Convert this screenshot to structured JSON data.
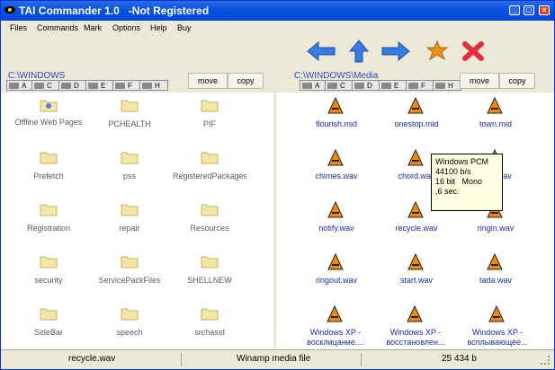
{
  "titlebar": {
    "title": "TAI Commander 1.0   -Not Registered"
  },
  "menu": [
    "Files",
    "Commands",
    "Mark",
    "Options",
    "Help",
    "Buy"
  ],
  "left_panel": {
    "path": "C:\\WINDOWS",
    "move_label": "move",
    "copy_label": "copy",
    "drives": [
      "A",
      "C",
      "D",
      "E",
      "F",
      "H"
    ],
    "items": [
      "Offline Web Pages",
      "PCHEALTH",
      "PIF",
      "Prefetch",
      "pss",
      "RegisteredPackages",
      "Registration",
      "repair",
      "Resources",
      "security",
      "ServicePackFiles",
      "SHELLNEW",
      "SideBar",
      "speech",
      "srchasst"
    ]
  },
  "right_panel": {
    "path": "C:\\WINDOWS\\Media",
    "move_label": "move",
    "copy_label": "copy",
    "drives": [
      "A",
      "C",
      "D",
      "E",
      "F",
      "H"
    ],
    "items": [
      "flourish.mid",
      "onestop.mid",
      "town.mid",
      "chimes.wav",
      "chord.wav",
      "ding.wav",
      "notify.wav",
      "recycle.wav",
      "ringin.wav",
      "ringout.wav",
      "start.wav",
      "tada.wav",
      "Windows XP - восклицание....",
      "Windows XP - восстановлен...",
      "Windows XP - всплывающее..."
    ]
  },
  "tooltip": {
    "line1": "Windows PCM",
    "line2": "44100 b/s",
    "line3": "16 bit   Mono",
    "line4": ",6 sec."
  },
  "status": {
    "file": "recycle.wav",
    "type": "Winamp media file",
    "size": "25 434 b"
  },
  "colors": {
    "title": "#0A55E0",
    "arrow": "#3A7BE0",
    "star": "#E8901E",
    "x": "#E03040"
  }
}
